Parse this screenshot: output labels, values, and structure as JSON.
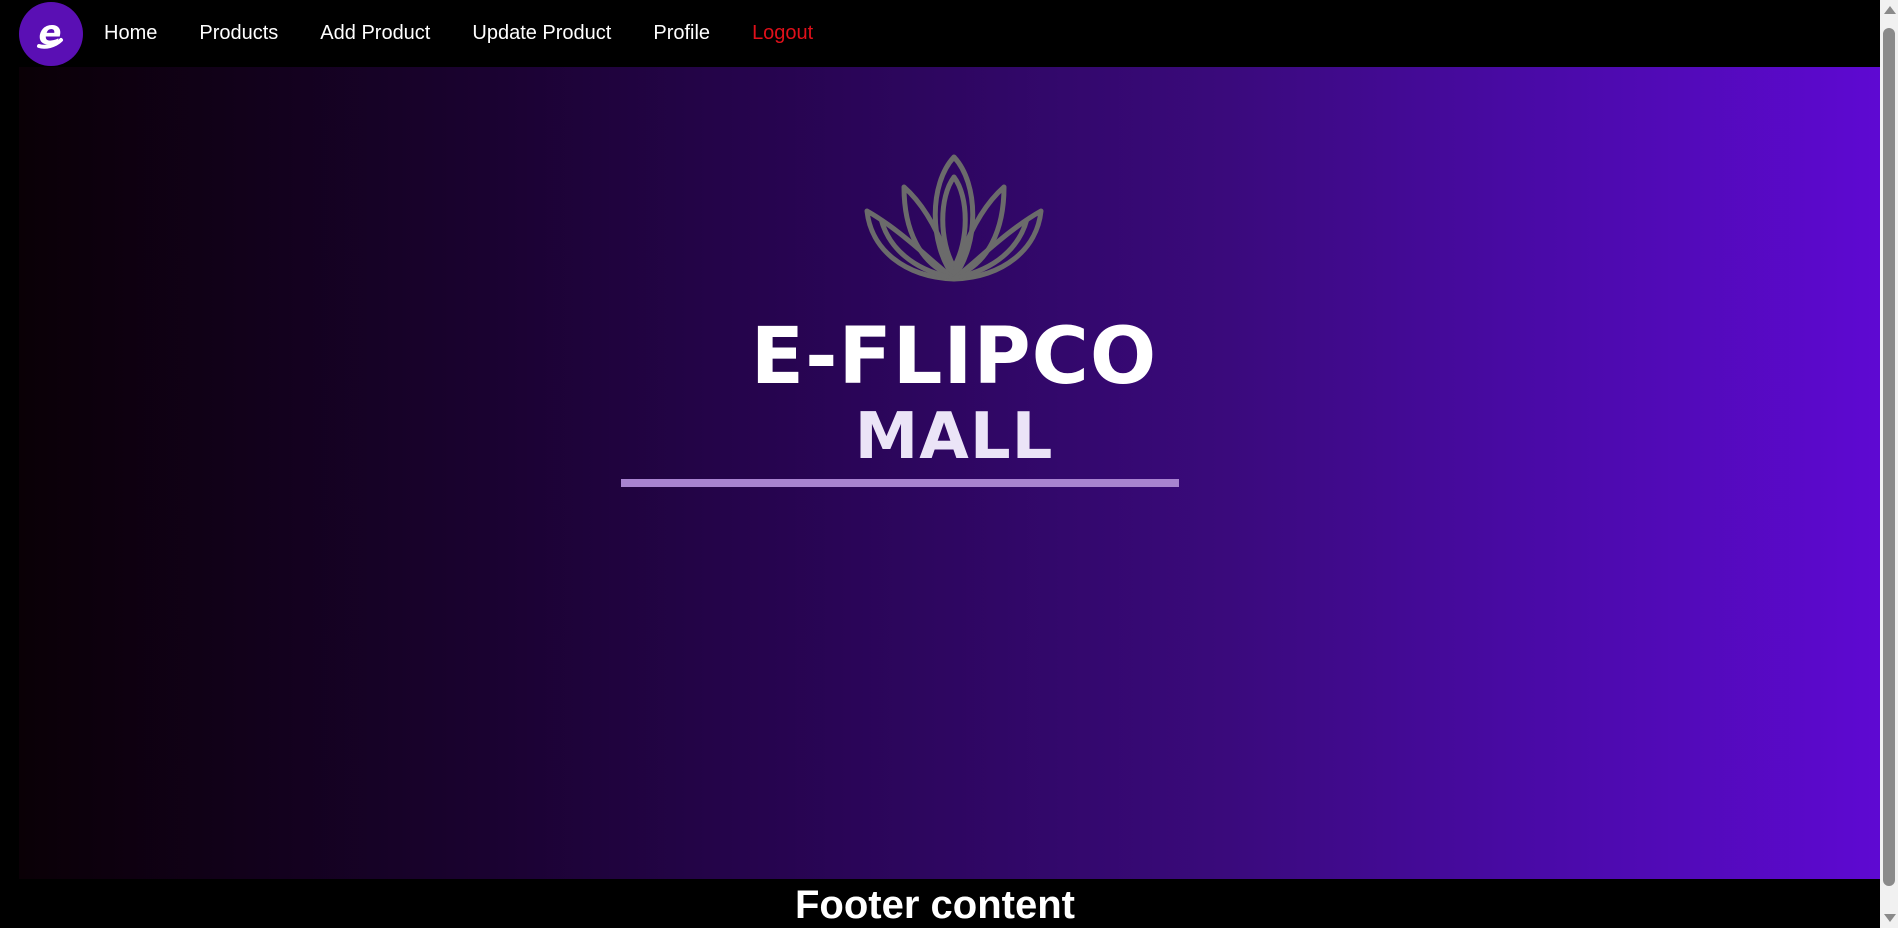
{
  "nav": {
    "logo_icon": "e-logo-icon",
    "logo_letter": "e",
    "items": [
      {
        "label": "Home"
      },
      {
        "label": "Products"
      },
      {
        "label": "Add Product"
      },
      {
        "label": "Update Product"
      },
      {
        "label": "Profile"
      },
      {
        "label": "Logout"
      }
    ]
  },
  "hero": {
    "brand_icon": "lotus-icon",
    "title": "E-FLIPCO",
    "subtitle": "MALL"
  },
  "footer": {
    "text": "Footer content"
  },
  "colors": {
    "accent": "#5a0fb4",
    "logout": "#e0101a",
    "gradient_start": "#0a0006",
    "gradient_end": "#5e09d2"
  }
}
